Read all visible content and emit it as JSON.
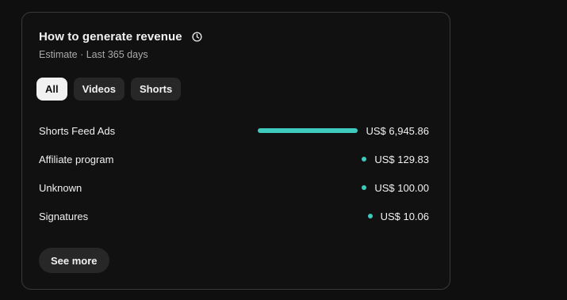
{
  "card": {
    "title": "How to generate revenue",
    "subtitle": "Estimate · Last 365 days",
    "icon": "clock-icon"
  },
  "filters": [
    {
      "label": "All",
      "active": true
    },
    {
      "label": "Videos",
      "active": false
    },
    {
      "label": "Shorts",
      "active": false
    }
  ],
  "revenue_sources": [
    {
      "label": "Shorts Feed Ads",
      "value": "US$ 6,945.86",
      "amount": 6945.86
    },
    {
      "label": "Affiliate program",
      "value": "US$ 129.83",
      "amount": 129.83
    },
    {
      "label": "Unknown",
      "value": "US$ 100.00",
      "amount": 100.0
    },
    {
      "label": "Signatures",
      "value": "US$ 10.06",
      "amount": 10.06
    }
  ],
  "accent_color": "#3ecbbd",
  "see_more_label": "See more"
}
